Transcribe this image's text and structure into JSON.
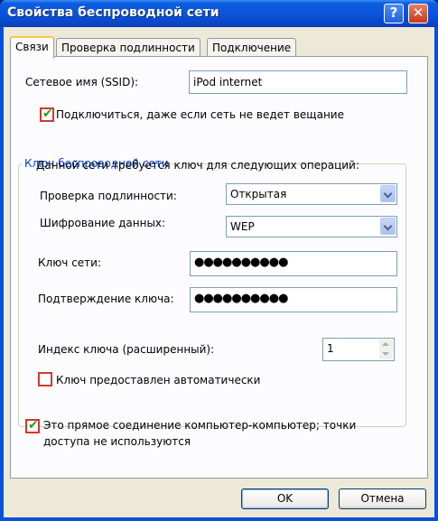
{
  "window": {
    "title": "Свойства беспроводной сети",
    "help_label": "?",
    "close_label": "✕"
  },
  "tabs": [
    {
      "label": "Связи",
      "active": true
    },
    {
      "label": "Проверка подлинности",
      "active": false
    },
    {
      "label": "Подключение",
      "active": false
    }
  ],
  "ssid": {
    "label": "Сетевое имя (SSID):",
    "value": "iPod internet"
  },
  "broadcast_checkbox": {
    "label": "Подключиться, даже если сеть не ведет вещание",
    "checked": true
  },
  "key_group": {
    "legend": "Ключ беспроводной сети",
    "description": "Данной сети требуется ключ для следующих операций:",
    "auth": {
      "label": "Проверка подлинности:",
      "value": "Открытая"
    },
    "encryption": {
      "label": "Шифрование данных:",
      "value": "WEP"
    },
    "network_key": {
      "label": "Ключ сети:",
      "value": "●●●●●●●●●●"
    },
    "confirm_key": {
      "label": "Подтверждение ключа:",
      "value": "●●●●●●●●●●"
    },
    "key_index": {
      "label": "Индекс ключа (расширенный):",
      "value": "1"
    },
    "auto_key": {
      "label": "Ключ предоставлен автоматически",
      "checked": false
    }
  },
  "adhoc_checkbox": {
    "label_line1": "Это прямое соединение компьютер-компьютер; точки",
    "label_line2": "доступа не используются",
    "checked": true
  },
  "buttons": {
    "ok": "OK",
    "cancel": "Отмена"
  },
  "colors": {
    "titlebar": "#0a55da",
    "dialog_bg": "#ece9d8",
    "group_legend": "#0046d5",
    "checkbox_highlight": "#d03a2e",
    "checkmark": "#21a121"
  }
}
